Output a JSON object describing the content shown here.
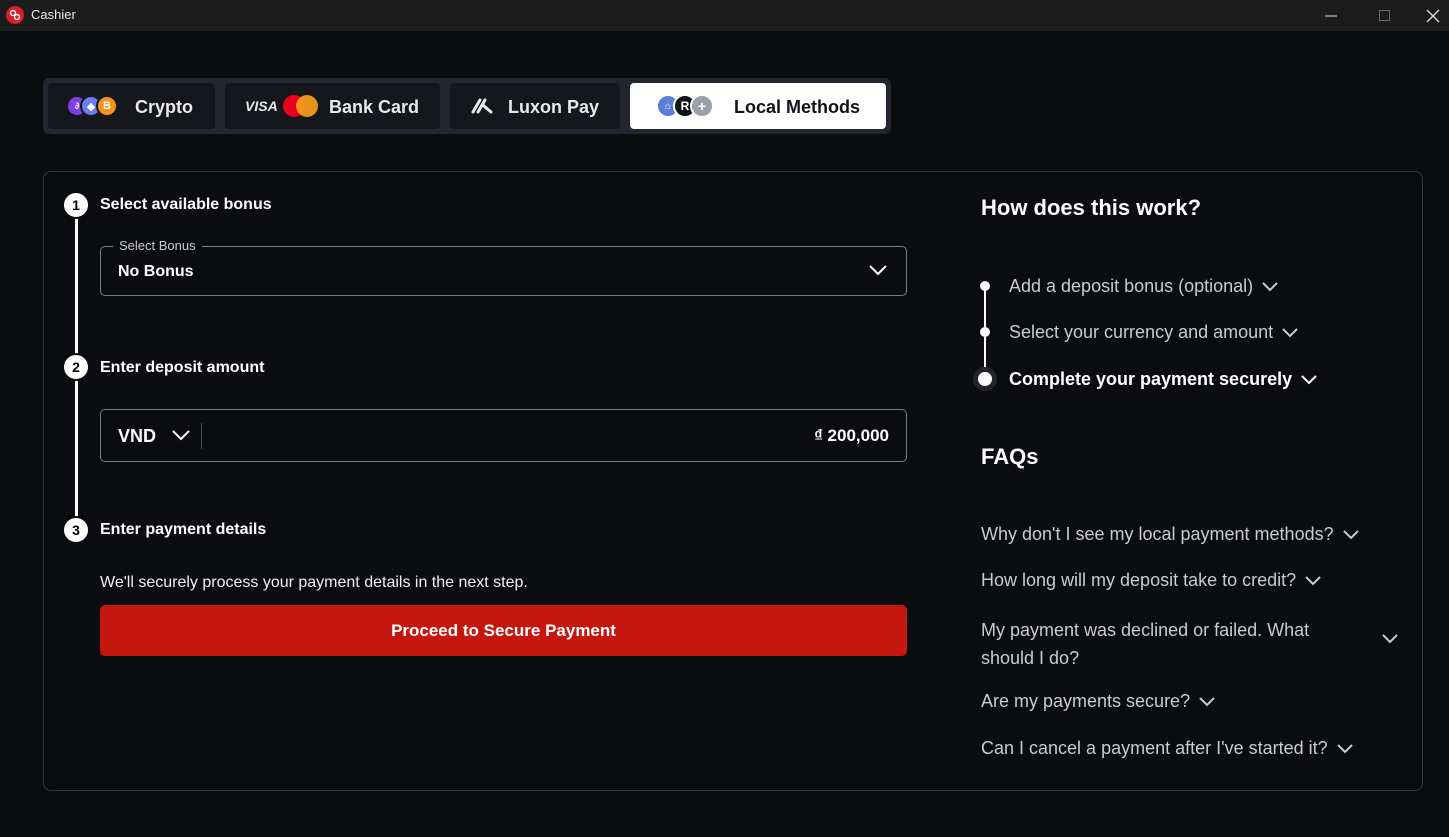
{
  "window": {
    "title": "Cashier"
  },
  "tabs": [
    {
      "label": "Crypto",
      "icon": "crypto-coins-icon"
    },
    {
      "label": "Bank Card",
      "icon": "visa-mastercard-icon",
      "visa_text": "VISA"
    },
    {
      "label": "Luxon Pay",
      "icon": "luxon-icon"
    },
    {
      "label": "Local Methods",
      "icon": "local-methods-icon",
      "active": true
    }
  ],
  "steps": {
    "bonus": {
      "number": "1",
      "title": "Select available bonus",
      "legend": "Select Bonus",
      "value": "No Bonus"
    },
    "amount": {
      "number": "2",
      "title": "Enter deposit amount",
      "currency": "VND",
      "value": "₫ 200,000"
    },
    "payment": {
      "number": "3",
      "title": "Enter payment details",
      "note": "We'll securely process your payment details in the next step.",
      "button": "Proceed to Secure Payment"
    }
  },
  "how": {
    "title": "How does this work?",
    "items": [
      "Add a deposit bonus (optional)",
      "Select your currency and amount",
      "Complete your payment securely"
    ]
  },
  "faqs": {
    "title": "FAQs",
    "items": [
      "Why don't I see my local payment methods?",
      "How long will my deposit take to credit?",
      "My payment was declined or failed. What should I do?",
      "Are my payments secure?",
      "Can I cancel a payment after I've started it?"
    ]
  },
  "colors": {
    "background": "#0b0c0f",
    "accent_red": "#c5160f",
    "active_tab": "#ffffff"
  }
}
